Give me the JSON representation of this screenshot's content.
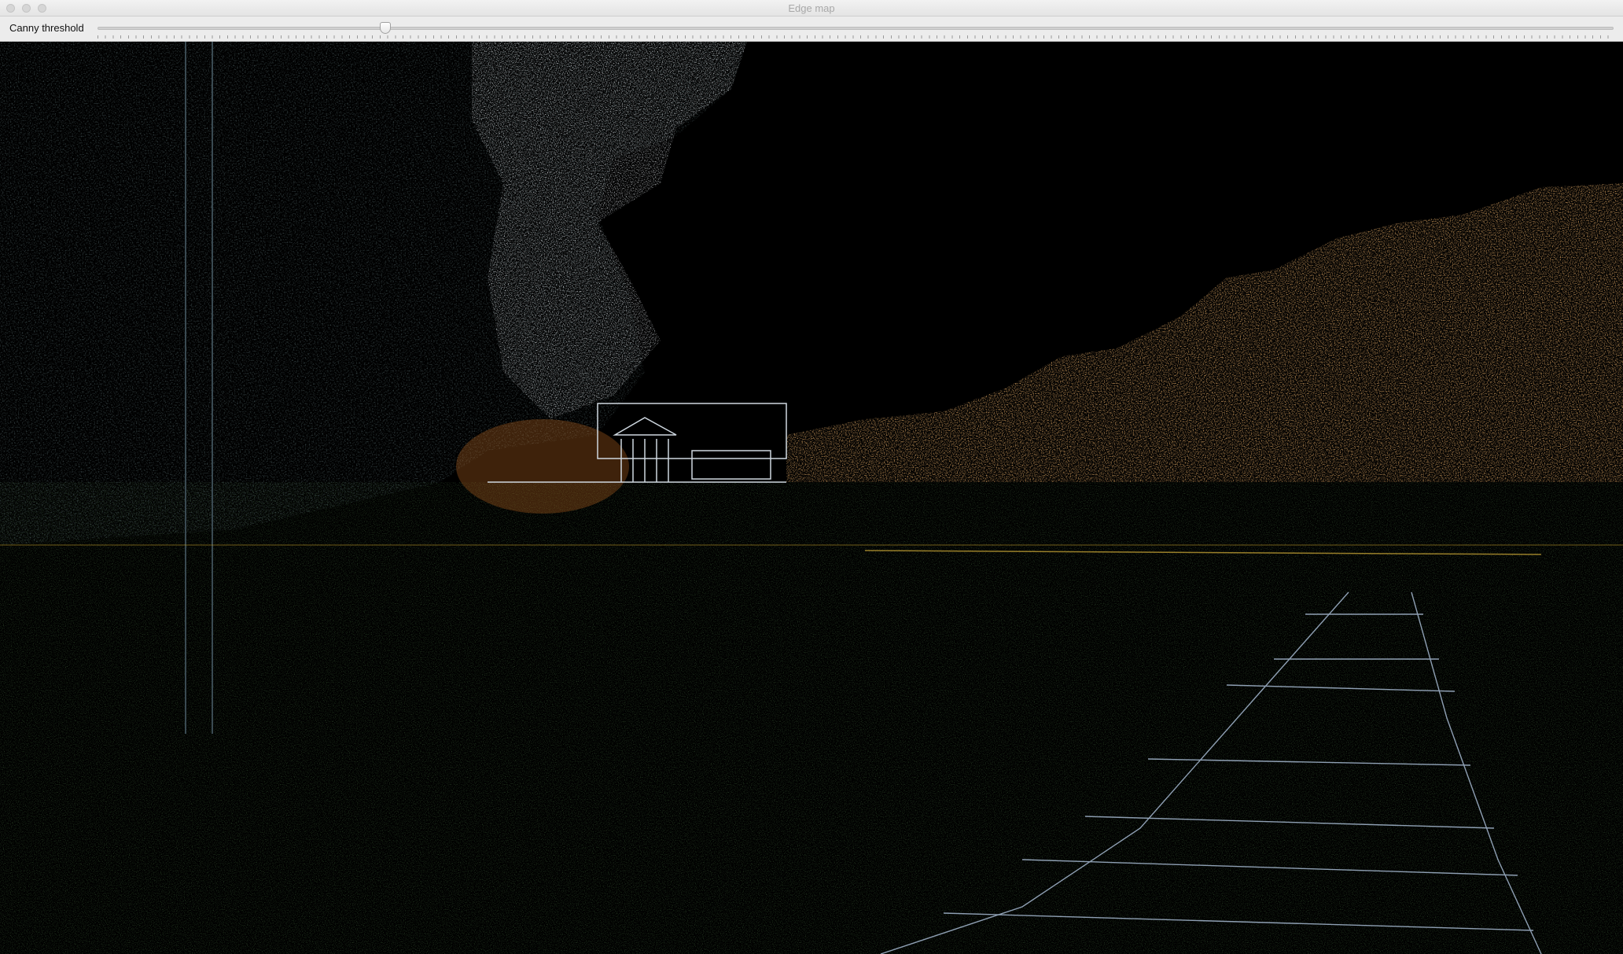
{
  "window": {
    "title": "Edge map"
  },
  "trackbar": {
    "label": "Canny threshold",
    "position_fraction": 0.19
  },
  "image": {
    "description_colors": {
      "background": "#000000",
      "foliage_left": "#2a3a2a",
      "foliage_white": "#d9e6ee",
      "autumn_trees": "#c9712a",
      "grass": "#1f3a14",
      "path_edges": "#9fb0c4"
    }
  }
}
